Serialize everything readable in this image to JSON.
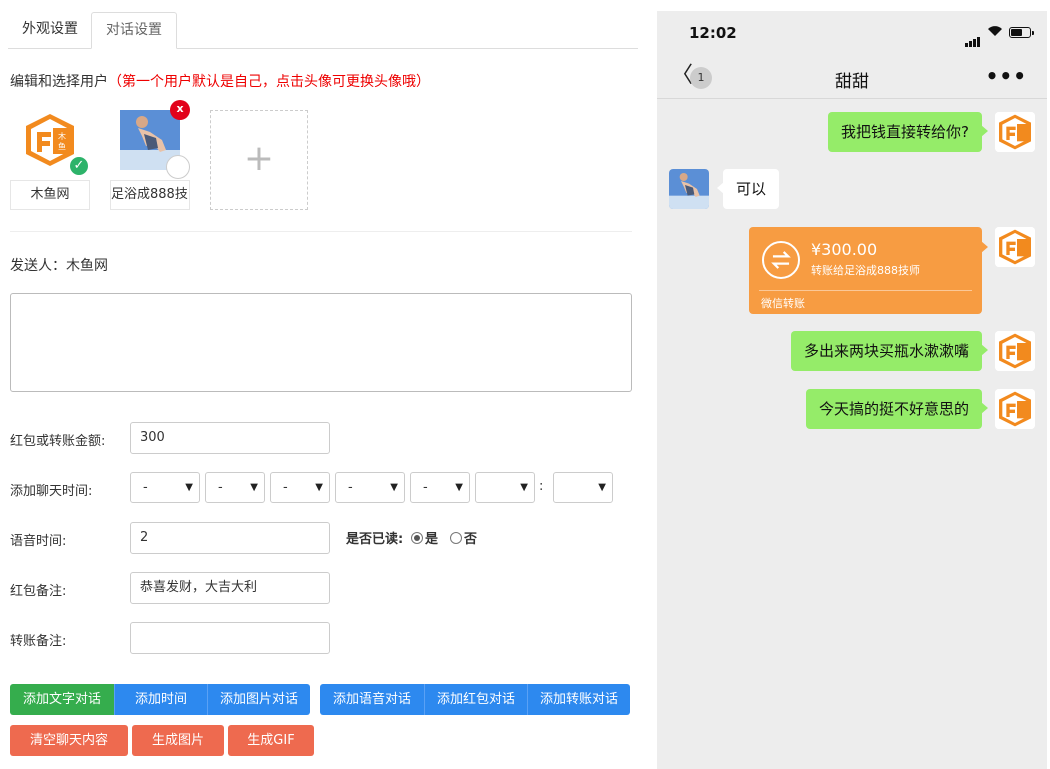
{
  "tabs": [
    "外观设置",
    "对话设置"
  ],
  "hint": {
    "text": "编辑和选择用户",
    "red": "（第一个用户默认是自己，点击头像可更换头像哦）"
  },
  "users": [
    {
      "name": "木鱼网"
    },
    {
      "name": "足浴成888技师"
    }
  ],
  "delete_mark": "x",
  "check_mark": "✓",
  "add_symbol": "+",
  "sender": "发送人：木鱼网",
  "form": {
    "amount_label": "红包或转账金额:",
    "amount_value": "300",
    "time_label": "添加聊天时间:",
    "time_selects": [
      "-",
      "-",
      "-",
      "-",
      "-",
      "",
      ""
    ],
    "colon": ":",
    "voice_label": "语音时间:",
    "voice_value": "2",
    "read_label": "是否已读:",
    "read_yes": "是",
    "read_no": "否",
    "read_selected": "是",
    "hb_note_label": "红包备注:",
    "hb_note_value": "恭喜发财，大吉大利",
    "tr_note_label": "转账备注:",
    "tr_note_value": ""
  },
  "buttons": {
    "row1": [
      "添加文字对话",
      "添加时间",
      "添加图片对话",
      "添加语音对话",
      "添加红包对话",
      "添加转账对话"
    ],
    "row2": [
      "清空聊天内容",
      "生成图片",
      "生成GIF"
    ]
  },
  "phone": {
    "time": "12:02",
    "badge": "1",
    "title": "甜甜",
    "more": "•••",
    "back": "〈",
    "messages": [
      {
        "from": "me",
        "text": "我把钱直接转给你?"
      },
      {
        "from": "them",
        "text": "可以"
      },
      {
        "from": "me",
        "type": "transfer",
        "amount": "¥300.00",
        "desc": "转账给足浴成888技师",
        "footer": "微信转账"
      },
      {
        "from": "me",
        "text": "多出来两块买瓶水漱漱嘴"
      },
      {
        "from": "me",
        "text": "今天搞的挺不好意思的"
      }
    ]
  },
  "colors": {
    "bubble_me": "#95ec69",
    "transfer": "#f79c42",
    "btn_green": "#35ad4d",
    "btn_blue": "#2d89ef",
    "btn_orange": "#ee6a4f",
    "hint_red": "#e00000"
  },
  "icons": [
    "check-icon",
    "delete-icon",
    "plus-icon",
    "back-icon",
    "more-icon",
    "signal-icon",
    "wifi-icon",
    "battery-icon",
    "transfer-icon"
  ]
}
